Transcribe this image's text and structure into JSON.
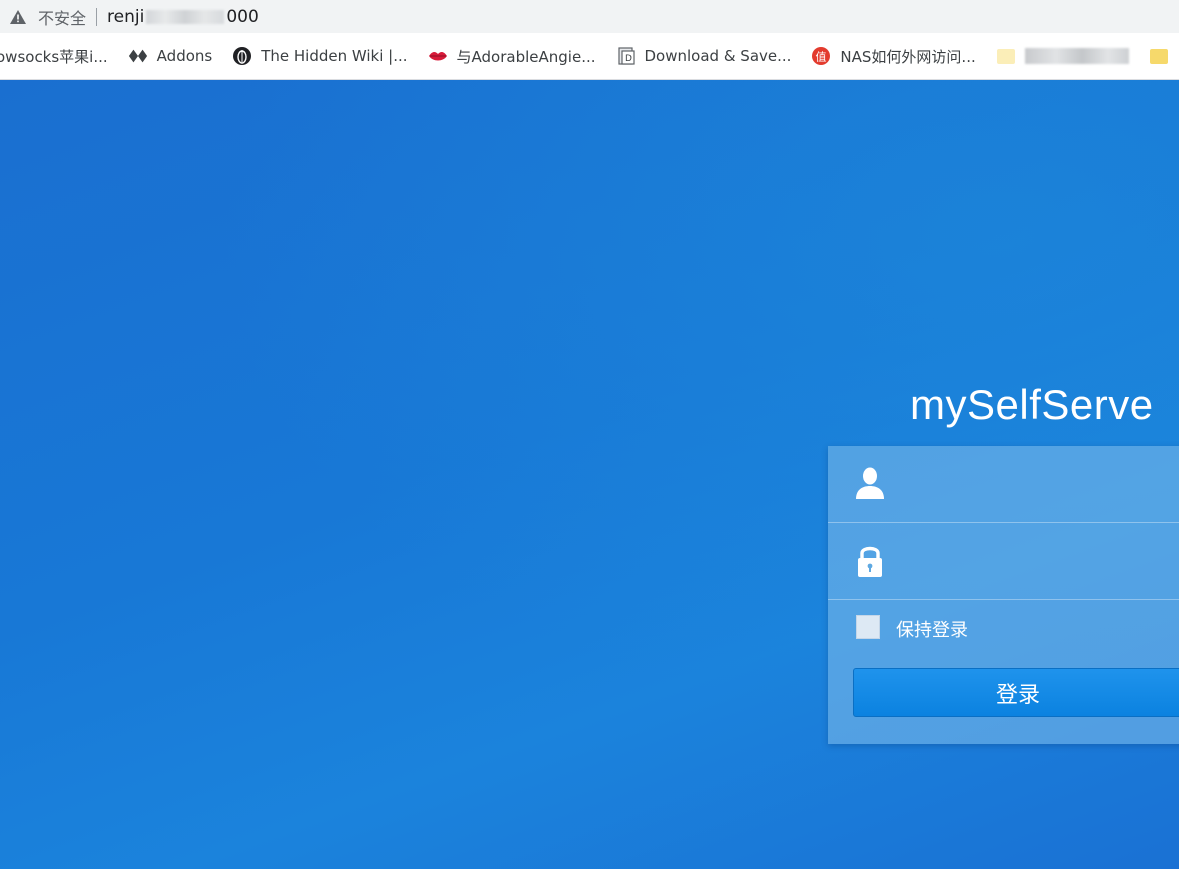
{
  "address_bar": {
    "security_label": "不安全",
    "url_prefix": "renji",
    "url_suffix": "000"
  },
  "bookmarks": [
    {
      "label": "owsocks苹果i...",
      "icon": "none"
    },
    {
      "label": "Addons",
      "icon": "addons-icon"
    },
    {
      "label": "The Hidden Wiki |...",
      "icon": "onion-icon"
    },
    {
      "label": "与AdorableAngie...",
      "icon": "lips-icon"
    },
    {
      "label": "Download & Save...",
      "icon": "document-icon"
    },
    {
      "label": "NAS如何外网访问...",
      "icon": "zhi-icon"
    }
  ],
  "brand": {
    "title": "mySelfServe"
  },
  "login": {
    "username_placeholder": "",
    "password_placeholder": "",
    "remember_label": "保持登录",
    "remember_checked": false,
    "submit_label": "登录"
  },
  "colors": {
    "background": "#1a78d6",
    "panel": "#5fa9e2",
    "button": "#1289e4"
  }
}
